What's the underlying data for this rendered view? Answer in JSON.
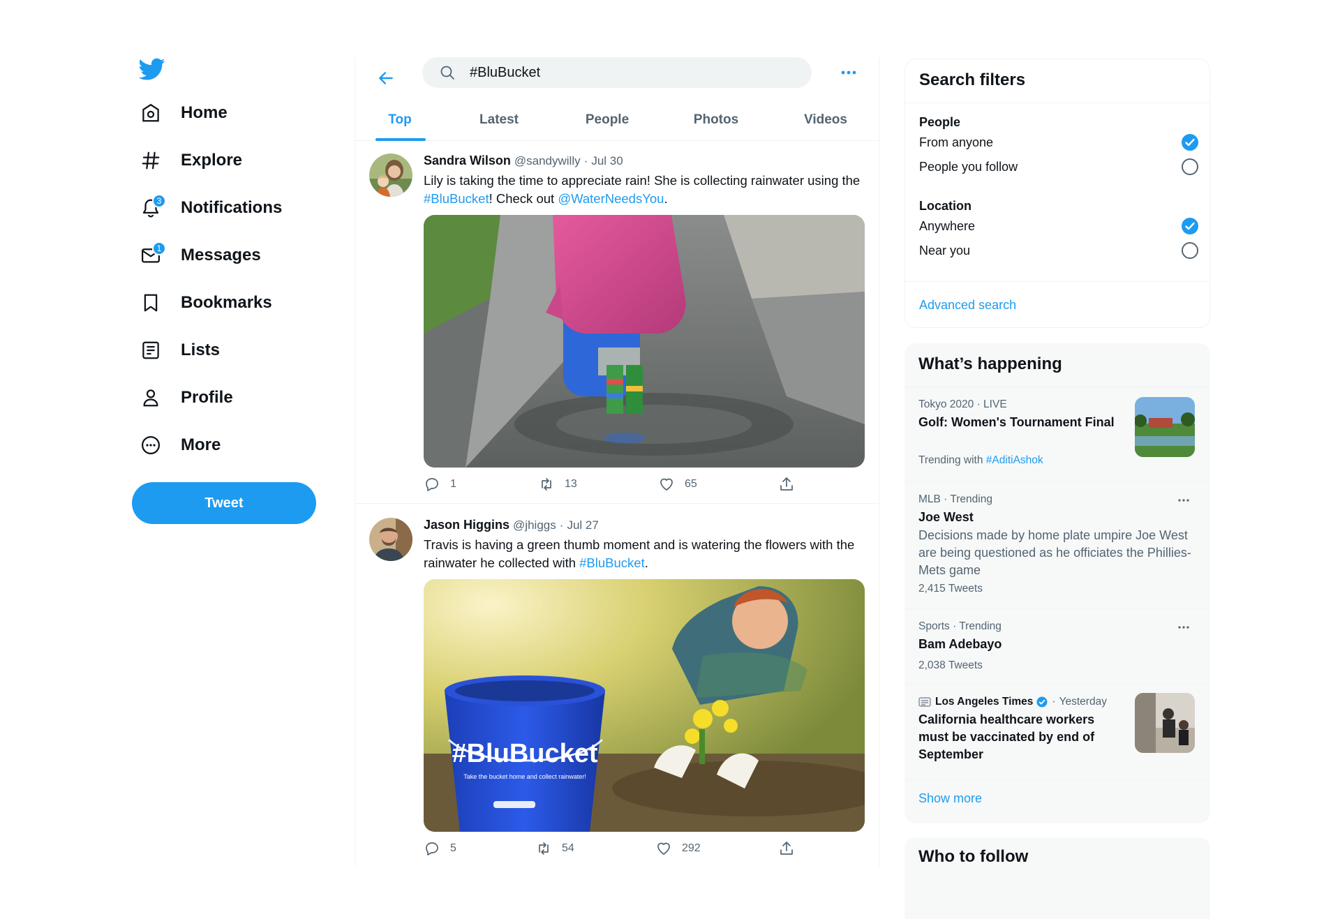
{
  "nav": {
    "items": [
      {
        "label": "Home",
        "icon": "home-icon"
      },
      {
        "label": "Explore",
        "icon": "hashtag-icon"
      },
      {
        "label": "Notifications",
        "icon": "bell-icon",
        "badge": "3"
      },
      {
        "label": "Messages",
        "icon": "envelope-icon",
        "badge": "1"
      },
      {
        "label": "Bookmarks",
        "icon": "bookmark-icon"
      },
      {
        "label": "Lists",
        "icon": "list-icon"
      },
      {
        "label": "Profile",
        "icon": "person-icon"
      },
      {
        "label": "More",
        "icon": "more-circle-icon"
      }
    ],
    "tweet_button": "Tweet"
  },
  "search": {
    "value": "#BluBucket"
  },
  "tabs": [
    "Top",
    "Latest",
    "People",
    "Photos",
    "Videos"
  ],
  "active_tab": "Top",
  "tweets": [
    {
      "name": "Sandra Wilson",
      "handle": "@sandywilly",
      "dot": "·",
      "date": "Jul 30",
      "text_parts": [
        "Lily is taking the time to appreciate rain! She is collecting rainwater using the ",
        "#BluBucket",
        "! Check out ",
        "@WaterNeedsYou",
        "."
      ],
      "replies": "1",
      "retweets": "13",
      "likes": "65"
    },
    {
      "name": "Jason Higgins",
      "handle": "@jhiggs",
      "dot": "·",
      "date": "Jul 27",
      "text_parts": [
        "Travis is having a green thumb moment and is watering the flowers with the rainwater he collected with ",
        "#BluBucket",
        "."
      ],
      "media_text": "#BluBucket",
      "media_subtext": "Take the bucket home and collect rainwater!",
      "replies": "5",
      "retweets": "54",
      "likes": "292"
    }
  ],
  "filters": {
    "title": "Search filters",
    "people_label": "People",
    "people_options": [
      "From anyone",
      "People you follow"
    ],
    "people_selected": 0,
    "location_label": "Location",
    "location_options": [
      "Anywhere",
      "Near you"
    ],
    "location_selected": 0,
    "advanced": "Advanced search"
  },
  "happening": {
    "title": "What’s happening",
    "trends": [
      {
        "meta": "Tokyo 2020 · LIVE",
        "title": "Golf: Women's Tournament Final",
        "trending_with": "Trending with",
        "tag": "#AditiAshok"
      },
      {
        "meta": "MLB · Trending",
        "title": "Joe West",
        "desc": "Decisions made by home plate umpire Joe West are being questioned as he officiates the Phillies-Mets game",
        "count": "2,415 Tweets"
      },
      {
        "meta": "Sports · Trending",
        "title": "Bam Adebayo",
        "count": "2,038 Tweets"
      },
      {
        "source": "Los Angeles Times",
        "dot": "·",
        "time": "Yesterday",
        "title": "California healthcare workers must be vaccinated by end of September"
      }
    ],
    "show_more": "Show more"
  },
  "who_to_follow": {
    "title": "Who to follow"
  },
  "colors": {
    "accent": "#1d9bf0",
    "text": "#0f1419",
    "muted": "#536471",
    "panel_bg": "#f7f9f9"
  }
}
